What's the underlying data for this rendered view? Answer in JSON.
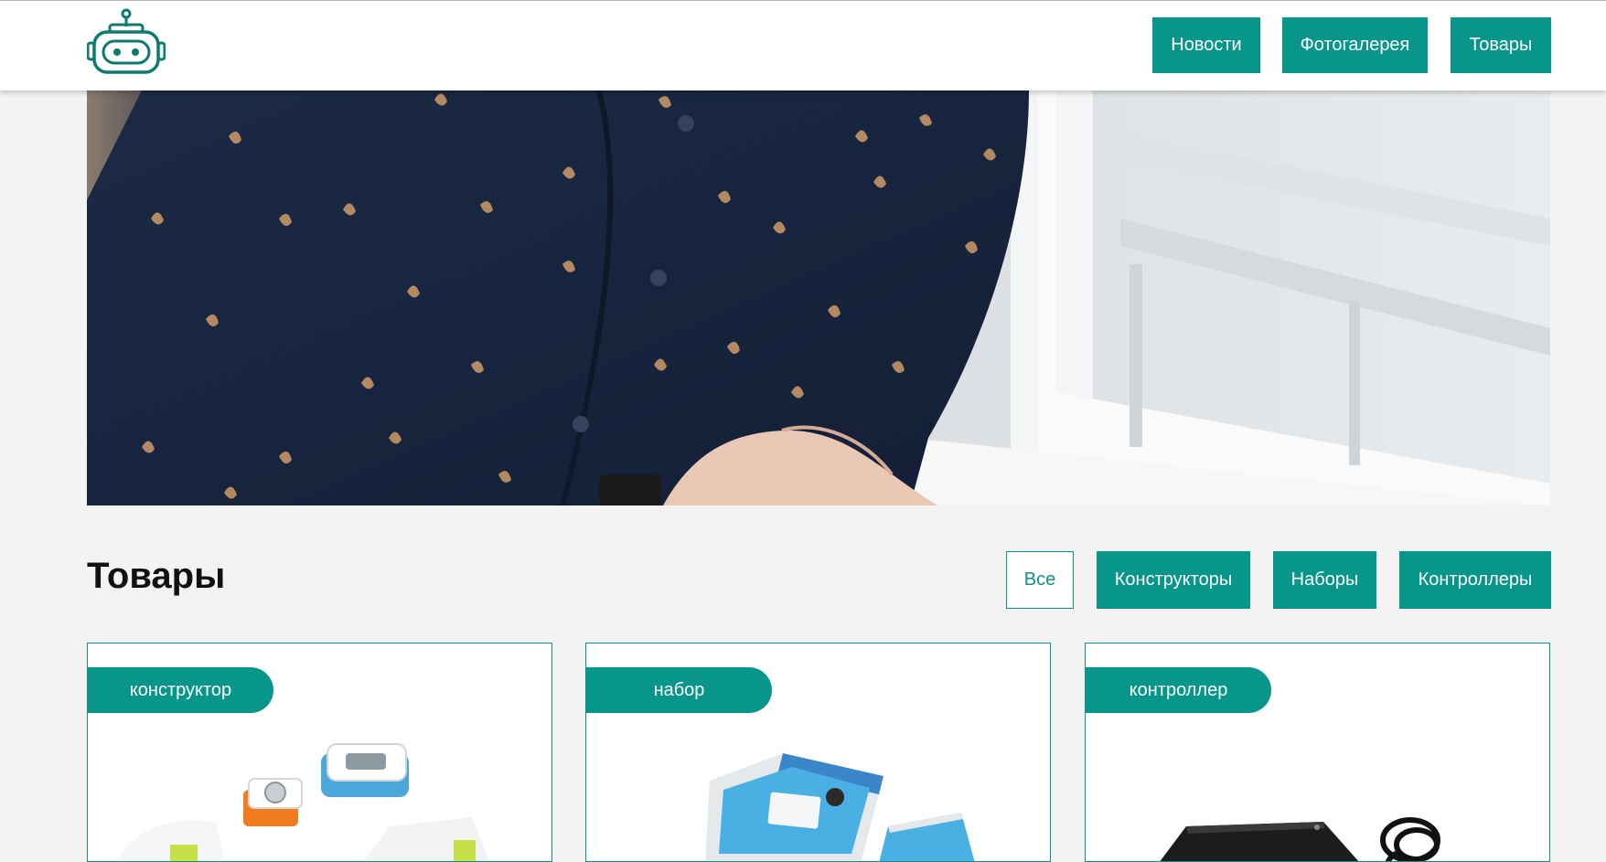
{
  "header": {
    "logo_icon": "robot-head-icon",
    "nav": [
      {
        "label": "Новости"
      },
      {
        "label": "Фотогалерея"
      },
      {
        "label": "Товары"
      }
    ]
  },
  "hero": {
    "image": "person-in-navy-leaf-print-shirt-by-window"
  },
  "products": {
    "title": "Товары",
    "filters": [
      {
        "label": "Все",
        "active": true
      },
      {
        "label": "Конструкторы",
        "active": false
      },
      {
        "label": "Наборы",
        "active": false
      },
      {
        "label": "Контроллеры",
        "active": false
      }
    ],
    "cards": [
      {
        "tag": "конструктор",
        "image": "modular-robotics-blocks"
      },
      {
        "tag": "набор",
        "image": "boxed-kit"
      },
      {
        "tag": "контроллер",
        "image": "black-controller-with-cable"
      }
    ]
  },
  "colors": {
    "accent": "#08968a",
    "background": "#f3f3f3",
    "header_bg": "#ffffff"
  }
}
